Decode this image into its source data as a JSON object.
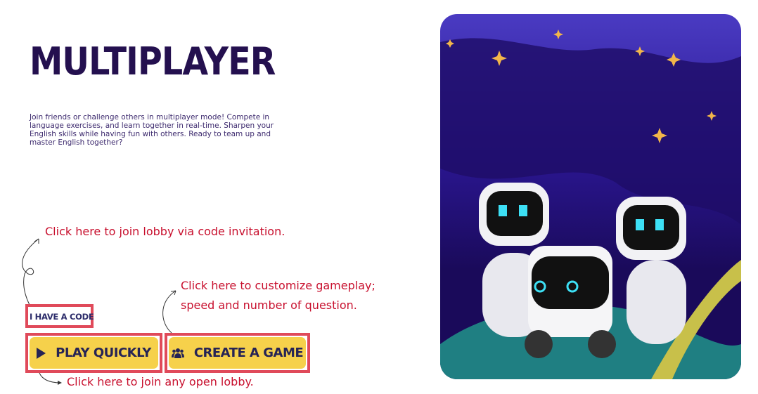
{
  "title": "MULTIPLAYER",
  "description": "Join friends or challenge others in multiplayer mode! Compete in language exercises, and learn together in real-time. Sharpen your English skills while having fun with others. Ready to team up and master English together?",
  "annotations": {
    "code": "Click here to join lobby via code invitation.",
    "create_line1": "Click here to customize gameplay;",
    "create_line2": "speed and number of question.",
    "play": "Click here to join any open lobby."
  },
  "buttons": {
    "have_code": "I HAVE A CODE",
    "play_quickly": "PLAY QUICKLY",
    "create_game": "CREATE A GAME"
  },
  "icons": {
    "play": "play-icon",
    "create": "users-icon"
  },
  "colors": {
    "title": "#24104f",
    "annotation": "#c8102e",
    "button": "#f6d14b",
    "highlight": "#e04a5a"
  }
}
